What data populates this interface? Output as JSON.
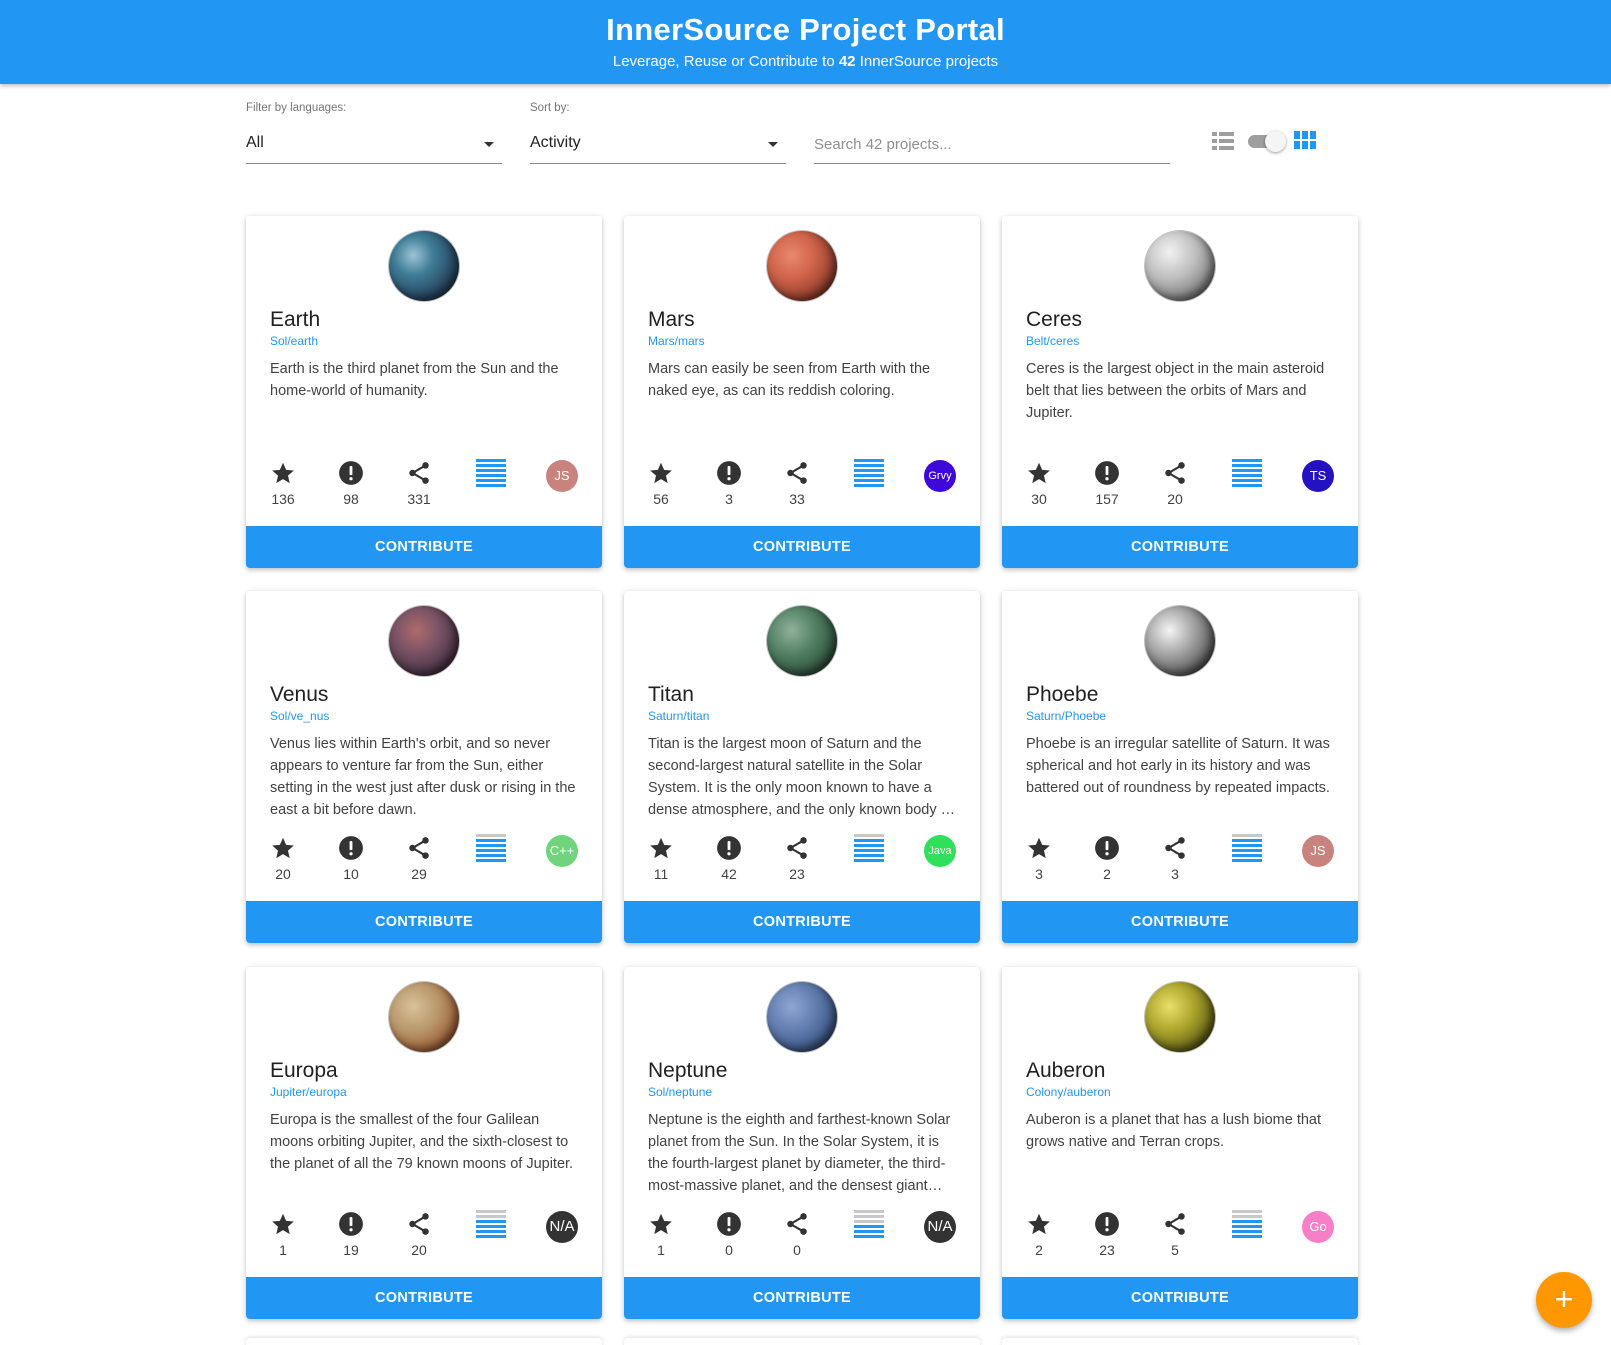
{
  "header": {
    "title": "InnerSource Project Portal",
    "subtitle_prefix": "Leverage, Reuse or Contribute to ",
    "project_count": "42",
    "subtitle_suffix": " InnerSource projects",
    "color": "#2196f3"
  },
  "filters": {
    "language_label": "Filter by languages:",
    "language_value": "All",
    "sort_label": "Sort by:",
    "sort_value": "Activity",
    "search_placeholder": "Search 42 projects..."
  },
  "view_toggle": {
    "list_icon": "list-view-icon",
    "grid_icon": "grid-view-icon",
    "current": "grid"
  },
  "contribute_label": "CONTRIBUTE",
  "icons": {
    "stars": "star-icon",
    "issues": "issue-icon",
    "forks": "fork-icon",
    "activity": "activity-bars-icon"
  },
  "projects": [
    {
      "name": "Earth",
      "repo": "Sol/earth",
      "description": "Earth is the third planet from the Sun and the home-world of humanity.",
      "stars": "136",
      "issues": "98",
      "forks": "331",
      "activity": 6,
      "language": "JS",
      "language_color": "#c9837e"
    },
    {
      "name": "Mars",
      "repo": "Mars/mars",
      "description": "Mars can easily be seen from Earth with the naked eye, as can its reddish coloring.",
      "stars": "56",
      "issues": "3",
      "forks": "33",
      "activity": 6,
      "language": "Grvy",
      "language_color": "#3d08d9"
    },
    {
      "name": "Ceres",
      "repo": "Belt/ceres",
      "description": "Ceres is the largest object in the main asteroid belt that lies between the orbits of Mars and Jupiter.",
      "stars": "30",
      "issues": "157",
      "forks": "20",
      "activity": 6,
      "language": "TS",
      "language_color": "#2412c2"
    },
    {
      "name": "Venus",
      "repo": "Sol/ve_nus",
      "description": "Venus lies within Earth's orbit, and so never appears to venture far from the Sun, either setting in the west just after dusk or rising in the east a bit before dawn.",
      "stars": "20",
      "issues": "10",
      "forks": "29",
      "activity": 5,
      "language": "C++",
      "language_color": "#6fd47b"
    },
    {
      "name": "Titan",
      "repo": "Saturn/titan",
      "description": "Titan is the largest moon of Saturn and the second-largest natural satellite in the Solar System. It is the only moon known to have a dense atmosphere, and the only known body in space, other than Earth, where clear evidence of stable bodies of surface liquid has been found.",
      "stars": "11",
      "issues": "42",
      "forks": "23",
      "activity": 5,
      "language": "Java",
      "language_color": "#2ee05a"
    },
    {
      "name": "Phoebe",
      "repo": "Saturn/Phoebe",
      "description": "Phoebe is an irregular satellite of Saturn. It was spherical and hot early in its history and was battered out of roundness by repeated impacts.",
      "stars": "3",
      "issues": "2",
      "forks": "3",
      "activity": 5,
      "language": "JS",
      "language_color": "#c9837e"
    },
    {
      "name": "Europa",
      "repo": "Jupiter/europa",
      "description": "Europa is the smallest of the four Galilean moons orbiting Jupiter, and the sixth-closest to the planet of all the 79 known moons of Jupiter.",
      "stars": "1",
      "issues": "19",
      "forks": "20",
      "activity": 4,
      "language": "N/A",
      "language_color": "#333333"
    },
    {
      "name": "Neptune",
      "repo": "Sol/neptune",
      "description": "Neptune is the eighth and farthest-known Solar planet from the Sun. In the Solar System, it is the fourth-largest planet by diameter, the third-most-massive planet, and the densest giant planet.",
      "stars": "1",
      "issues": "0",
      "forks": "0",
      "activity": 3,
      "language": "N/A",
      "language_color": "#333333"
    },
    {
      "name": "Auberon",
      "repo": "Colony/auberon",
      "description": "Auberon is a planet that has a lush biome that grows native and Terran crops.",
      "stars": "2",
      "issues": "23",
      "forks": "5",
      "activity": 4,
      "language": "Go",
      "language_color": "#f77fc8"
    }
  ],
  "fab_label": "+"
}
